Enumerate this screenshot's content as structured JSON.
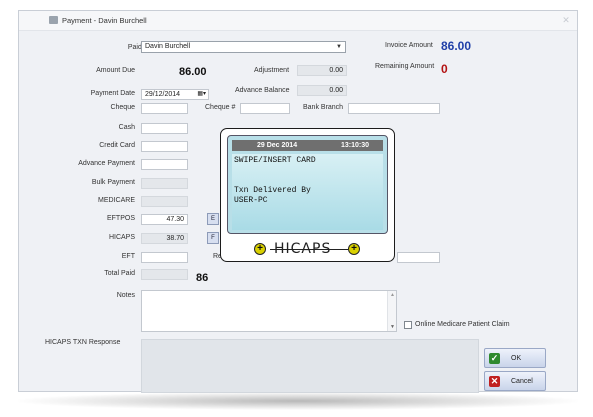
{
  "window": {
    "title": "Payment - Davin Burchell"
  },
  "form": {
    "paid_by_label": "Paid By",
    "paid_by_value": "Davin Burchell",
    "invoice_amount_label": "Invoice Amount",
    "invoice_amount_value": "86.00",
    "amount_due_label": "Amount Due",
    "amount_due_value": "86.00",
    "adjustment_label": "Adjustment",
    "adjustment_value": "0.00",
    "remaining_amount_label": "Remaining Amount",
    "remaining_amount_value": "0",
    "payment_date_label": "Payment Date",
    "payment_date_value": "29/12/2014",
    "advance_balance_label": "Advance Balance",
    "advance_balance_value": "0.00",
    "cheque_label": "Cheque",
    "cheque_no_label": "Cheque #",
    "bank_branch_label": "Bank Branch",
    "cash_label": "Cash",
    "credit_card_label": "Credit Card",
    "advance_payment_label": "Advance Payment",
    "bulk_payment_label": "Bulk Payment",
    "medicare_label": "MEDICARE",
    "eftpos_label": "EFTPOS",
    "eftpos_value": "47.30",
    "eftpos_btn": "E",
    "hicaps_label": "HICAPS",
    "hicaps_value": "38.70",
    "hicaps_btn": "F",
    "eft_label": "EFT",
    "reference_label": "Refe",
    "total_paid_label": "Total Paid",
    "total_paid_value": "86",
    "notes_label": "Notes",
    "online_medicare_label": "Online Medicare Patient Claim",
    "hicaps_txn_label": "HICAPS TXN Response"
  },
  "buttons": {
    "ok": "OK",
    "cancel": "Cancel"
  },
  "terminal": {
    "date": "29 Dec 2014",
    "time": "13:10:30",
    "line1": "SWIPE/INSERT CARD",
    "line2": "Txn Delivered By",
    "line3": "USER-PC",
    "logo": "HICAPS"
  },
  "colors": {
    "invoice_amount": "#1f3fa8",
    "remaining_amount": "#b31212",
    "ok_icon": "#2f8a2f",
    "cancel_icon": "#c02020"
  }
}
